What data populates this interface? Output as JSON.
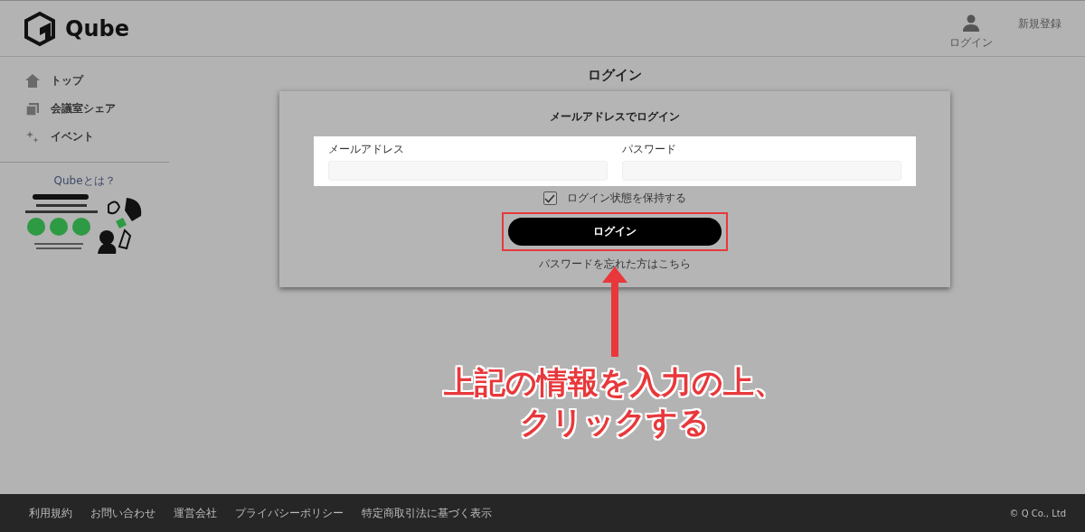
{
  "header": {
    "logo": "Qube",
    "login": "ログイン",
    "signup": "新規登録"
  },
  "sidebar": {
    "items": [
      {
        "label": "トップ",
        "kind": "home"
      },
      {
        "label": "会議室シェア",
        "kind": "rooms"
      },
      {
        "label": "イベント",
        "kind": "event"
      }
    ],
    "promo": {
      "title": "Qubeとは？",
      "kind": "picture"
    }
  },
  "page_title": "ログイン",
  "form": {
    "heading": "メールアドレスでログイン",
    "fields": [
      {
        "label": "メールアドレス"
      },
      {
        "label": "パスワード"
      }
    ],
    "remember": {
      "label": "ログイン状態を保持する",
      "checked": true
    },
    "submit": "ログイン",
    "forgot": "パスワードを忘れた方はこちら"
  },
  "annotation": {
    "lines": [
      "上記の情報を入力の上、",
      "クリックする"
    ]
  },
  "footer": {
    "links": [
      "利用規約",
      "お問い合わせ",
      "運営会社",
      "プライバシーポリシー",
      "特定商取引法に基づく表示"
    ],
    "copyright": "© Q Co., Ltd"
  }
}
